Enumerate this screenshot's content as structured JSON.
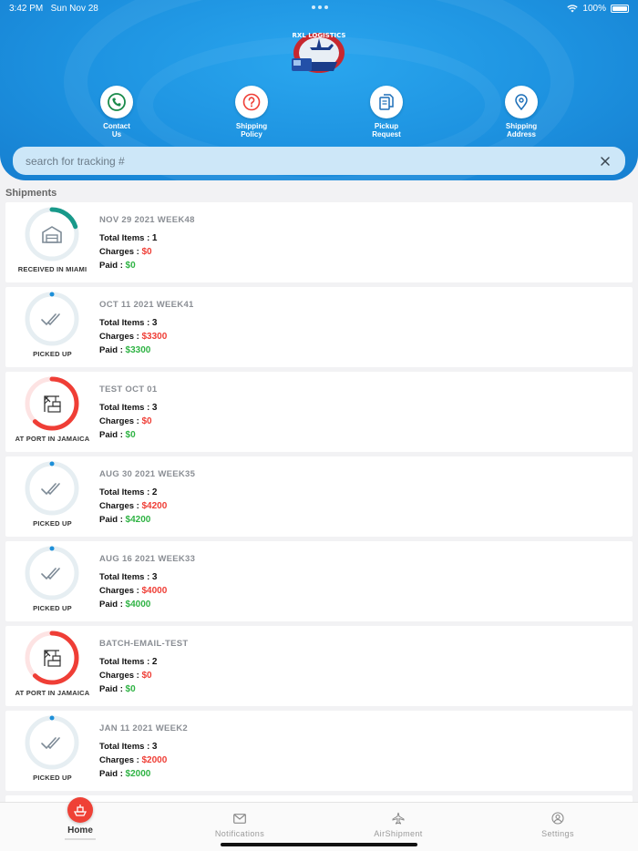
{
  "status": {
    "time": "3:42 PM",
    "date": "Sun Nov 28",
    "battery": "100%"
  },
  "brand": {
    "logo_text": "RXL LOGISTICS"
  },
  "quick_actions": [
    {
      "label_line1": "Contact",
      "label_line2": "Us",
      "icon": "phone-icon",
      "color": "#1a8a4a"
    },
    {
      "label_line1": "Shipping",
      "label_line2": "Policy",
      "icon": "question-icon",
      "color": "#ef3e36"
    },
    {
      "label_line1": "Pickup",
      "label_line2": "Request",
      "icon": "documents-icon",
      "color": "#1d6fb8"
    },
    {
      "label_line1": "Shipping",
      "label_line2": "Address",
      "icon": "location-pin-icon",
      "color": "#1d6fb8"
    }
  ],
  "search": {
    "placeholder": "search for tracking #"
  },
  "section_title": "Shipments",
  "shipments": [
    {
      "title": "NOV 29 2021 WEEK48",
      "status": "RECEIVED IN MIAMI",
      "icon": "warehouse-icon",
      "progress": 0.2,
      "ring_color": "#18998a",
      "total_items_label": "Total Items :",
      "total_items": "1",
      "charges_label": "Charges :",
      "charges": "$0",
      "paid_label": "Paid :",
      "paid": "$0"
    },
    {
      "title": "OCT 11 2021 WEEK41",
      "status": "PICKED UP",
      "icon": "double-check-icon",
      "progress": 0,
      "ring_color": "#1d8fd8",
      "total_items_label": "Total Items :",
      "total_items": "3",
      "charges_label": "Charges :",
      "charges": "$3300",
      "paid_label": "Paid :",
      "paid": "$3300"
    },
    {
      "title": "TEST OCT 01",
      "status": "AT PORT IN JAMAICA",
      "icon": "port-crane-icon",
      "progress": 0.62,
      "ring_color": "#ef3e36",
      "total_items_label": "Total Items :",
      "total_items": "3",
      "charges_label": "Charges :",
      "charges": "$0",
      "paid_label": "Paid :",
      "paid": "$0"
    },
    {
      "title": "AUG 30 2021 WEEK35",
      "status": "PICKED UP",
      "icon": "double-check-icon",
      "progress": 0,
      "ring_color": "#1d8fd8",
      "total_items_label": "Total Items :",
      "total_items": "2",
      "charges_label": "Charges :",
      "charges": "$4200",
      "paid_label": "Paid :",
      "paid": "$4200"
    },
    {
      "title": "AUG 16 2021 WEEK33",
      "status": "PICKED UP",
      "icon": "double-check-icon",
      "progress": 0,
      "ring_color": "#1d8fd8",
      "total_items_label": "Total Items :",
      "total_items": "3",
      "charges_label": "Charges :",
      "charges": "$4000",
      "paid_label": "Paid :",
      "paid": "$4000"
    },
    {
      "title": "BATCH-EMAIL-TEST",
      "status": "AT PORT IN JAMAICA",
      "icon": "port-crane-icon",
      "progress": 0.62,
      "ring_color": "#ef3e36",
      "total_items_label": "Total Items :",
      "total_items": "2",
      "charges_label": "Charges :",
      "charges": "$0",
      "paid_label": "Paid :",
      "paid": "$0"
    },
    {
      "title": "JAN 11 2021 WEEK2",
      "status": "PICKED UP",
      "icon": "double-check-icon",
      "progress": 0,
      "ring_color": "#1d8fd8",
      "total_items_label": "Total Items :",
      "total_items": "3",
      "charges_label": "Charges :",
      "charges": "$2000",
      "paid_label": "Paid :",
      "paid": "$2000"
    }
  ],
  "tabs": {
    "home": "Home",
    "notifications": "Notifications",
    "airshipment": "AirShipment",
    "settings": "Settings"
  },
  "colors": {
    "header": "#1d92e0",
    "accent_red": "#ef3e36",
    "paid_green": "#2fb344"
  }
}
